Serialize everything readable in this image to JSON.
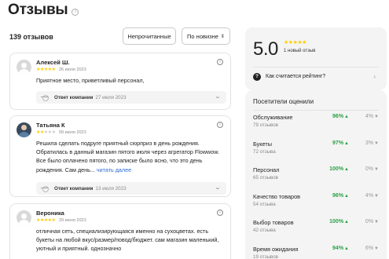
{
  "header": {
    "title": "Отзывы",
    "info_symbol": "i"
  },
  "toolbar": {
    "count": "139 отзывов",
    "unread_button": "Непрочитанные",
    "sort_button": "По новизне",
    "sort_arrow": "⇕"
  },
  "reviews": [
    {
      "author": "Алексей Ш.",
      "rating": 5,
      "date": "26 июля 2023",
      "text": "Приятное место, приветливый персонал,",
      "more": "",
      "reply_label": "Ответ компании",
      "reply_date": "27 июля 2023"
    },
    {
      "author": "Татьяна К",
      "rating": 2,
      "date": "09 июля 2023",
      "text": "Решила сделать подруге приятный сюрприз в день рождения. Обратилась в данный магазин пятого июля через агрегатор Flowwow. Все было оплачено пятого, по записке было ясно, что это день рождения. Сам день... ",
      "more": "читать далее",
      "reply_label": "Ответ компании",
      "reply_date": "13 июля 2023"
    },
    {
      "author": "Вероника",
      "rating": 5,
      "date": "29 июня 2023",
      "text": "отличная сеть, специализирующаяся именно на сухоцветах. есть букеты на любой вкус/размер/повод/бюджет. сам магазин маленький, уютный и приятный. однозначно",
      "more": "",
      "reply_label": "",
      "reply_date": ""
    }
  ],
  "rating_panel": {
    "score": "5.0",
    "stars": 5,
    "new_reviews": "1 новый отзыв",
    "how_calculated": "Как считается рейтинг?",
    "q_symbol": "?",
    "chevron": "›"
  },
  "visitors": {
    "title": "Посетители оценили",
    "aspects": [
      {
        "name": "Обслуживание",
        "count": "79 отзывов",
        "positive": "96%",
        "negative": "4%"
      },
      {
        "name": "Букеты",
        "count": "72 отзыва",
        "positive": "97%",
        "negative": "3%"
      },
      {
        "name": "Персонал",
        "count": "65 отзывов",
        "positive": "100%",
        "negative": "0%"
      },
      {
        "name": "Качество товаров",
        "count": "54 отзыва",
        "positive": "96%",
        "negative": "4%"
      },
      {
        "name": "Выбор товаров",
        "count": "42 отзыва",
        "positive": "100%",
        "negative": "0%"
      },
      {
        "name": "Время ожидания",
        "count": "19 отзывов",
        "positive": "94%",
        "negative": "6%"
      }
    ]
  },
  "colors": {
    "star": "#ffcc00",
    "positive": "#2aa146",
    "link": "#2b6bd6",
    "panel_bg": "#f4f4f4"
  },
  "icons": {
    "star": "★",
    "thumb_up": "👍",
    "thumb_down": "👎",
    "info": "i",
    "chevron_down": "⌄"
  }
}
